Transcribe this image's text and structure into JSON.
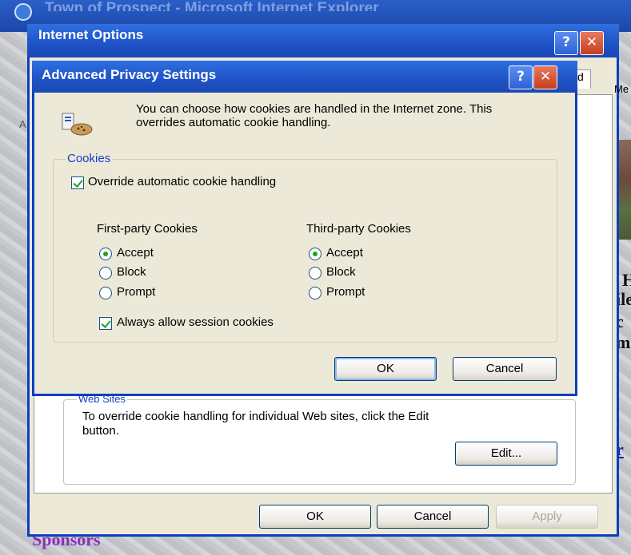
{
  "ie_window": {
    "title": "Town of Prospect - Microsoft Internet Explorer",
    "body_text": [
      "H",
      "ile",
      "c",
      "mi",
      "r"
    ],
    "sponsor_text": "Sponsors"
  },
  "internet_options": {
    "title": "Internet Options",
    "help_glyph": "?",
    "close_glyph": "✕",
    "tab_fragment": "d",
    "me_fragment": "Me",
    "a_fragment": "A",
    "websites": {
      "legend": "Web Sites",
      "description": "To override cookie handling for individual Web sites, click the Edit button.",
      "edit_label": "Edit..."
    },
    "buttons": {
      "ok": "OK",
      "cancel": "Cancel",
      "apply": "Apply"
    }
  },
  "advanced_privacy": {
    "title": "Advanced Privacy Settings",
    "help_glyph": "?",
    "close_glyph": "✕",
    "intro": "You can choose how cookies are handled in the Internet zone.  This overrides automatic cookie handling.",
    "group_label": "Cookies",
    "override_label": "Override automatic cookie handling",
    "override_checked": true,
    "first_party": {
      "heading": "First-party Cookies",
      "options": [
        "Accept",
        "Block",
        "Prompt"
      ],
      "selected": "Accept"
    },
    "third_party": {
      "heading": "Third-party Cookies",
      "options": [
        "Accept",
        "Block",
        "Prompt"
      ],
      "selected": "Accept"
    },
    "session_label": "Always allow session cookies",
    "session_checked": true,
    "buttons": {
      "ok": "OK",
      "cancel": "Cancel"
    }
  },
  "colors": {
    "titlebar": "#1f52c6",
    "dialog_face": "#ece9d8",
    "group_label": "#1a3cc8",
    "check_mark": "#21a121"
  }
}
